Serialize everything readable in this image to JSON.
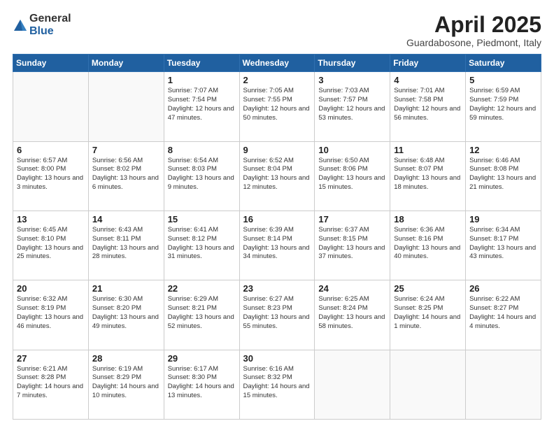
{
  "logo": {
    "general": "General",
    "blue": "Blue"
  },
  "header": {
    "month": "April 2025",
    "location": "Guardabosone, Piedmont, Italy"
  },
  "days_of_week": [
    "Sunday",
    "Monday",
    "Tuesday",
    "Wednesday",
    "Thursday",
    "Friday",
    "Saturday"
  ],
  "weeks": [
    [
      {
        "day": "",
        "info": ""
      },
      {
        "day": "",
        "info": ""
      },
      {
        "day": "1",
        "info": "Sunrise: 7:07 AM\nSunset: 7:54 PM\nDaylight: 12 hours and 47 minutes."
      },
      {
        "day": "2",
        "info": "Sunrise: 7:05 AM\nSunset: 7:55 PM\nDaylight: 12 hours and 50 minutes."
      },
      {
        "day": "3",
        "info": "Sunrise: 7:03 AM\nSunset: 7:57 PM\nDaylight: 12 hours and 53 minutes."
      },
      {
        "day": "4",
        "info": "Sunrise: 7:01 AM\nSunset: 7:58 PM\nDaylight: 12 hours and 56 minutes."
      },
      {
        "day": "5",
        "info": "Sunrise: 6:59 AM\nSunset: 7:59 PM\nDaylight: 12 hours and 59 minutes."
      }
    ],
    [
      {
        "day": "6",
        "info": "Sunrise: 6:57 AM\nSunset: 8:00 PM\nDaylight: 13 hours and 3 minutes."
      },
      {
        "day": "7",
        "info": "Sunrise: 6:56 AM\nSunset: 8:02 PM\nDaylight: 13 hours and 6 minutes."
      },
      {
        "day": "8",
        "info": "Sunrise: 6:54 AM\nSunset: 8:03 PM\nDaylight: 13 hours and 9 minutes."
      },
      {
        "day": "9",
        "info": "Sunrise: 6:52 AM\nSunset: 8:04 PM\nDaylight: 13 hours and 12 minutes."
      },
      {
        "day": "10",
        "info": "Sunrise: 6:50 AM\nSunset: 8:06 PM\nDaylight: 13 hours and 15 minutes."
      },
      {
        "day": "11",
        "info": "Sunrise: 6:48 AM\nSunset: 8:07 PM\nDaylight: 13 hours and 18 minutes."
      },
      {
        "day": "12",
        "info": "Sunrise: 6:46 AM\nSunset: 8:08 PM\nDaylight: 13 hours and 21 minutes."
      }
    ],
    [
      {
        "day": "13",
        "info": "Sunrise: 6:45 AM\nSunset: 8:10 PM\nDaylight: 13 hours and 25 minutes."
      },
      {
        "day": "14",
        "info": "Sunrise: 6:43 AM\nSunset: 8:11 PM\nDaylight: 13 hours and 28 minutes."
      },
      {
        "day": "15",
        "info": "Sunrise: 6:41 AM\nSunset: 8:12 PM\nDaylight: 13 hours and 31 minutes."
      },
      {
        "day": "16",
        "info": "Sunrise: 6:39 AM\nSunset: 8:14 PM\nDaylight: 13 hours and 34 minutes."
      },
      {
        "day": "17",
        "info": "Sunrise: 6:37 AM\nSunset: 8:15 PM\nDaylight: 13 hours and 37 minutes."
      },
      {
        "day": "18",
        "info": "Sunrise: 6:36 AM\nSunset: 8:16 PM\nDaylight: 13 hours and 40 minutes."
      },
      {
        "day": "19",
        "info": "Sunrise: 6:34 AM\nSunset: 8:17 PM\nDaylight: 13 hours and 43 minutes."
      }
    ],
    [
      {
        "day": "20",
        "info": "Sunrise: 6:32 AM\nSunset: 8:19 PM\nDaylight: 13 hours and 46 minutes."
      },
      {
        "day": "21",
        "info": "Sunrise: 6:30 AM\nSunset: 8:20 PM\nDaylight: 13 hours and 49 minutes."
      },
      {
        "day": "22",
        "info": "Sunrise: 6:29 AM\nSunset: 8:21 PM\nDaylight: 13 hours and 52 minutes."
      },
      {
        "day": "23",
        "info": "Sunrise: 6:27 AM\nSunset: 8:23 PM\nDaylight: 13 hours and 55 minutes."
      },
      {
        "day": "24",
        "info": "Sunrise: 6:25 AM\nSunset: 8:24 PM\nDaylight: 13 hours and 58 minutes."
      },
      {
        "day": "25",
        "info": "Sunrise: 6:24 AM\nSunset: 8:25 PM\nDaylight: 14 hours and 1 minute."
      },
      {
        "day": "26",
        "info": "Sunrise: 6:22 AM\nSunset: 8:27 PM\nDaylight: 14 hours and 4 minutes."
      }
    ],
    [
      {
        "day": "27",
        "info": "Sunrise: 6:21 AM\nSunset: 8:28 PM\nDaylight: 14 hours and 7 minutes."
      },
      {
        "day": "28",
        "info": "Sunrise: 6:19 AM\nSunset: 8:29 PM\nDaylight: 14 hours and 10 minutes."
      },
      {
        "day": "29",
        "info": "Sunrise: 6:17 AM\nSunset: 8:30 PM\nDaylight: 14 hours and 13 minutes."
      },
      {
        "day": "30",
        "info": "Sunrise: 6:16 AM\nSunset: 8:32 PM\nDaylight: 14 hours and 15 minutes."
      },
      {
        "day": "",
        "info": ""
      },
      {
        "day": "",
        "info": ""
      },
      {
        "day": "",
        "info": ""
      }
    ]
  ]
}
